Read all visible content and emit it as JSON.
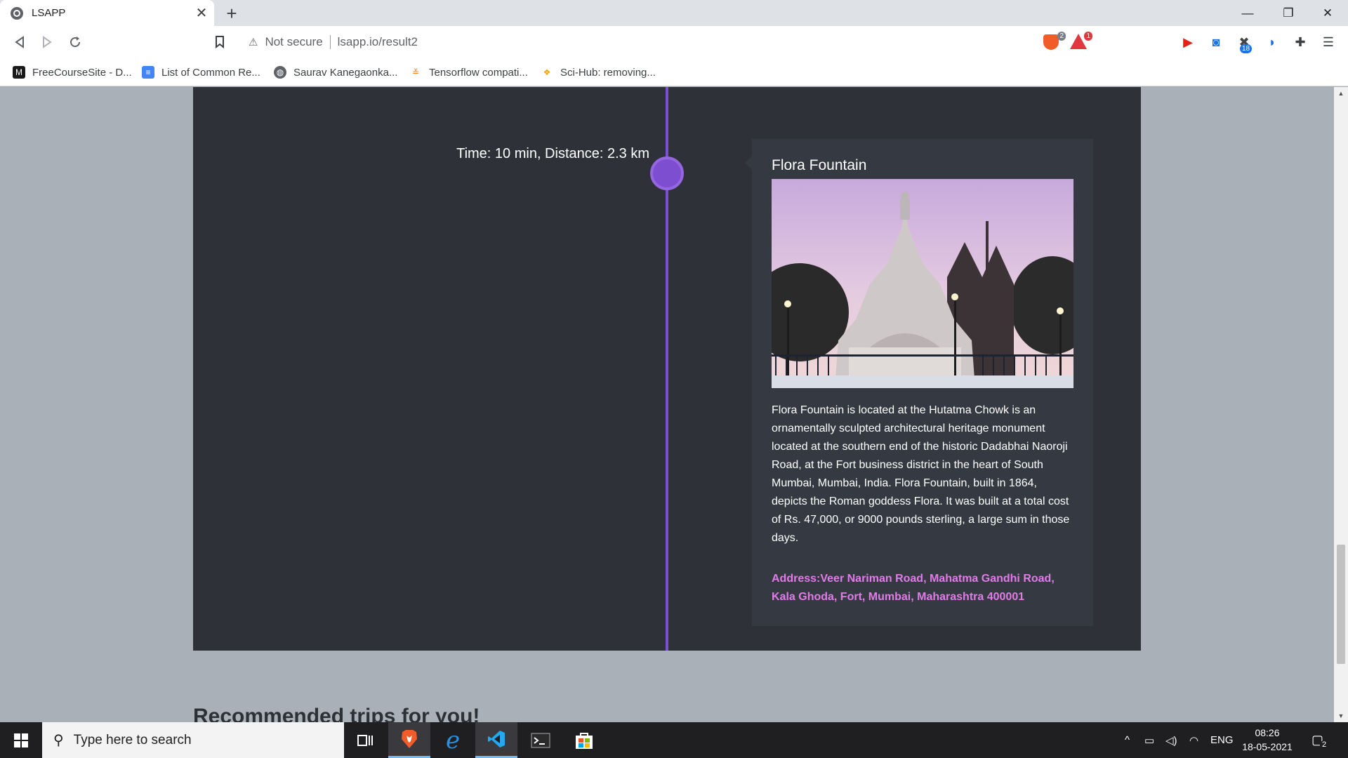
{
  "browser": {
    "tab_title": "LSAPP",
    "security_label": "Not secure",
    "url": "lsapp.io/result2",
    "shield_count": "2",
    "rewards_count": "1",
    "extension_badge": "18",
    "bookmarks": [
      {
        "label": "FreeCourseSite - D...",
        "icon": "fcs-icon",
        "color": "#1a1a1a"
      },
      {
        "label": "List of Common Re...",
        "icon": "docs-icon",
        "color": "#4285f4"
      },
      {
        "label": "Saurav Kanegaonka...",
        "icon": "globe-icon",
        "color": "#5f6368"
      },
      {
        "label": "Tensorflow compati...",
        "icon": "stackoverflow-icon",
        "color": "#f48024"
      },
      {
        "label": "Sci-Hub: removing...",
        "icon": "scihub-icon",
        "color": "#f7a600"
      }
    ]
  },
  "timeline": {
    "trip_info": "Time: 10 min, Distance: 2.3 km",
    "accent_color": "#7e4ed0"
  },
  "card": {
    "title": "Flora Fountain",
    "description": "Flora Fountain is located at the Hutatma Chowk is an ornamentally sculpted architectural heritage monument located at the southern end of the historic Dadabhai Naoroji Road, at the Fort business district in the heart of South Mumbai, Mumbai, India. Flora Fountain, built in 1864, depicts the Roman goddess Flora. It was built at a total cost of Rs. 47,000, or 9000 pounds sterling, a large sum in those days.",
    "address": "Address:Veer Nariman Road, Mahatma Gandhi Road, Kala Ghoda, Fort, Mumbai, Maharashtra 400001",
    "address_color": "#e07be8"
  },
  "section": {
    "recommended_heading": "Recommended trips for you!"
  },
  "taskbar": {
    "search_placeholder": "Type here to search",
    "language": "ENG",
    "time": "08:26",
    "date": "18-05-2021",
    "notification_count": "2"
  }
}
